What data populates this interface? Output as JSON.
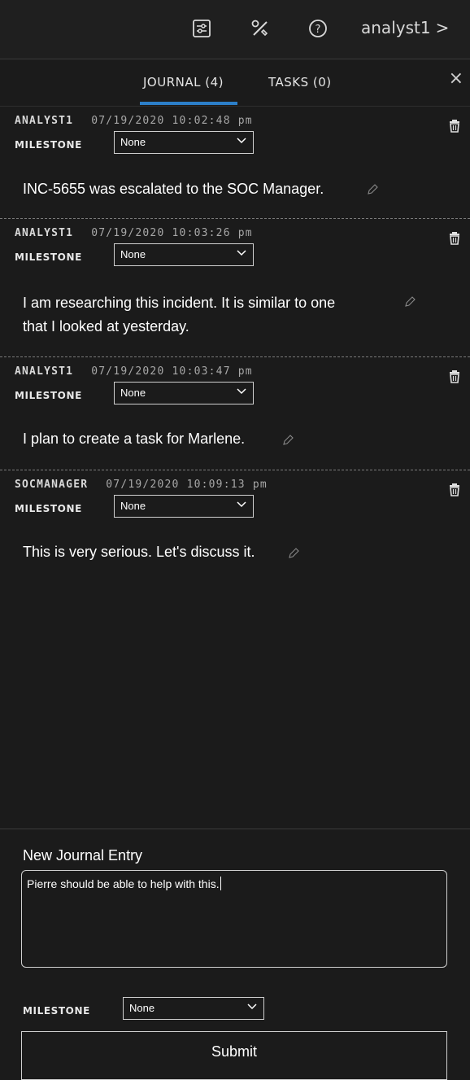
{
  "header": {
    "icons": [
      "settings-sliders-icon",
      "tools-icon",
      "help-icon"
    ],
    "user": "analyst1",
    "user_chevron": ">"
  },
  "tabs": [
    {
      "label": "JOURNAL (4)",
      "active": true
    },
    {
      "label": "TASKS (0)",
      "active": false
    }
  ],
  "close_label": "×",
  "milestone_label": "MILESTONE",
  "entries": [
    {
      "author": "ANALYST1",
      "timestamp": "07/19/2020 10:02:48 pm",
      "milestone": "None",
      "lines": [
        "INC-5655 was escalated to the SOC Manager."
      ]
    },
    {
      "author": "ANALYST1",
      "timestamp": "07/19/2020 10:03:26 pm",
      "milestone": "None",
      "lines": [
        "I am  researching this incident. It is similar to one",
        "that I looked at yesterday."
      ]
    },
    {
      "author": "ANALYST1",
      "timestamp": "07/19/2020 10:03:47 pm",
      "milestone": "None",
      "lines": [
        "I plan to create a task for Marlene."
      ]
    },
    {
      "author": "SOCMANAGER",
      "timestamp": "07/19/2020 10:09:13 pm",
      "milestone": "None",
      "lines": [
        "This is very serious. Let's discuss it."
      ]
    }
  ],
  "new_entry": {
    "title": "New Journal Entry",
    "text": "Pierre should be able to help with this.",
    "milestone_label": "MILESTONE",
    "milestone": "None",
    "submit_label": "Submit"
  },
  "colors": {
    "background": "#1b1b1b",
    "accent": "#2c7fc9",
    "border": "#d0d0d0"
  }
}
